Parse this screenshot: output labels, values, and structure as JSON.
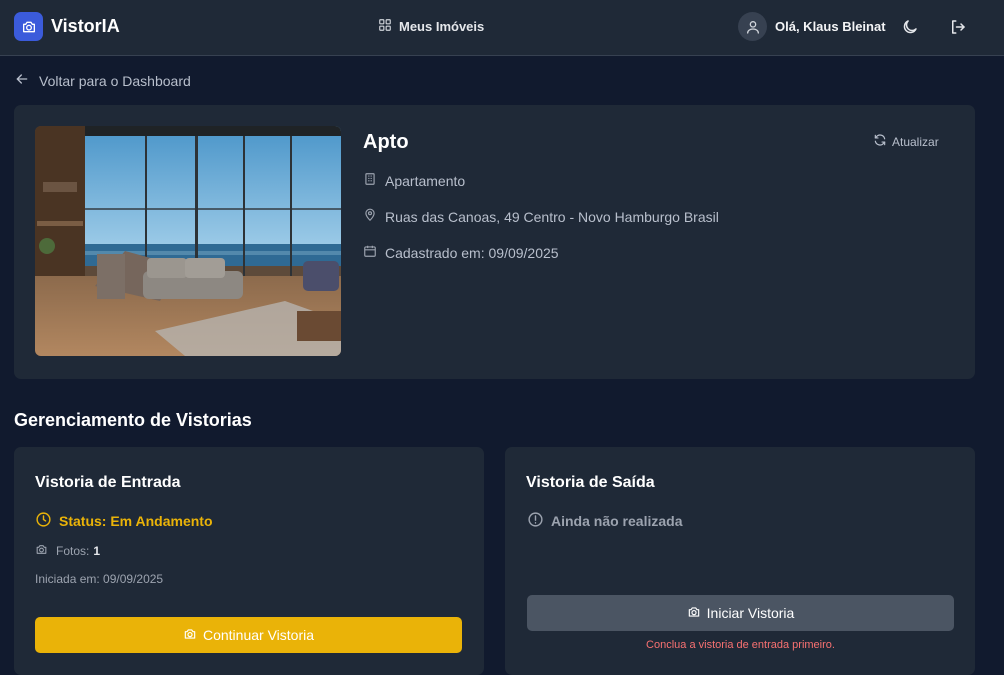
{
  "app": {
    "name": "VistorIA",
    "nav_label": "Meus Imóveis",
    "greeting": "Olá, Klaus Bleinat"
  },
  "icons": {
    "brand": "camera-icon",
    "nav": "grid-icon",
    "avatar": "user-icon",
    "theme": "moon-icon",
    "logout": "logout-icon",
    "back": "arrow-left-icon",
    "refresh": "refresh-icon",
    "type": "building-icon",
    "address": "map-pin-icon",
    "date": "calendar-icon",
    "status": "clock-icon",
    "photos": "camera-icon",
    "not_done": "alert-circle-icon"
  },
  "colors": {
    "brand": "#3b5bdb",
    "accent": "#eab308",
    "warning": "#f87171"
  },
  "back_link": "Voltar para o Dashboard",
  "property": {
    "title": "Apto",
    "refresh_label": "Atualizar",
    "type": "Apartamento",
    "address": "Ruas das Canoas, 49 Centro - Novo Hamburgo Brasil",
    "registered": "Cadastrado em: 09/09/2025"
  },
  "section_title": "Gerenciamento de Vistorias",
  "entry": {
    "title": "Vistoria de Entrada",
    "status": "Status: Em Andamento",
    "photos_label": "Fotos:",
    "photos_count": "1",
    "started": "Iniciada em: 09/09/2025",
    "button": "Continuar Vistoria"
  },
  "exit": {
    "title": "Vistoria de Saída",
    "status": "Ainda não realizada",
    "button": "Iniciar Vistoria",
    "warning": "Conclua a vistoria de entrada primeiro."
  }
}
